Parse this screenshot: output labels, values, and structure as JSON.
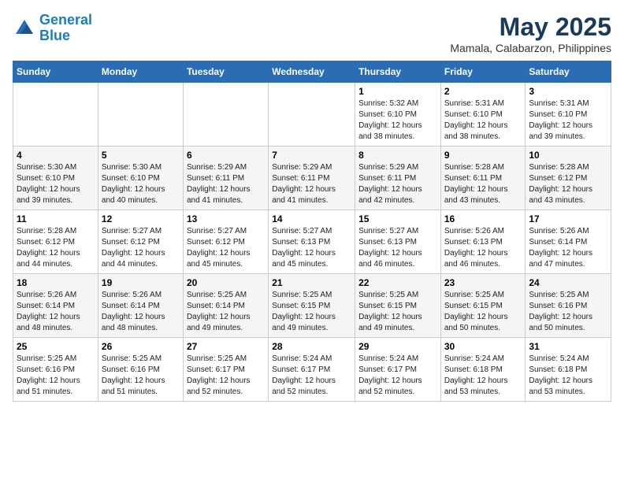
{
  "app": {
    "name": "GeneralBlue",
    "name_part1": "General",
    "name_part2": "Blue"
  },
  "title": {
    "month_year": "May 2025",
    "location": "Mamala, Calabarzon, Philippines"
  },
  "headers": [
    "Sunday",
    "Monday",
    "Tuesday",
    "Wednesday",
    "Thursday",
    "Friday",
    "Saturday"
  ],
  "weeks": [
    {
      "days": [
        {
          "num": "",
          "info": ""
        },
        {
          "num": "",
          "info": ""
        },
        {
          "num": "",
          "info": ""
        },
        {
          "num": "",
          "info": ""
        },
        {
          "num": "1",
          "info": "Sunrise: 5:32 AM\nSunset: 6:10 PM\nDaylight: 12 hours\nand 38 minutes."
        },
        {
          "num": "2",
          "info": "Sunrise: 5:31 AM\nSunset: 6:10 PM\nDaylight: 12 hours\nand 38 minutes."
        },
        {
          "num": "3",
          "info": "Sunrise: 5:31 AM\nSunset: 6:10 PM\nDaylight: 12 hours\nand 39 minutes."
        }
      ]
    },
    {
      "days": [
        {
          "num": "4",
          "info": "Sunrise: 5:30 AM\nSunset: 6:10 PM\nDaylight: 12 hours\nand 39 minutes."
        },
        {
          "num": "5",
          "info": "Sunrise: 5:30 AM\nSunset: 6:10 PM\nDaylight: 12 hours\nand 40 minutes."
        },
        {
          "num": "6",
          "info": "Sunrise: 5:29 AM\nSunset: 6:11 PM\nDaylight: 12 hours\nand 41 minutes."
        },
        {
          "num": "7",
          "info": "Sunrise: 5:29 AM\nSunset: 6:11 PM\nDaylight: 12 hours\nand 41 minutes."
        },
        {
          "num": "8",
          "info": "Sunrise: 5:29 AM\nSunset: 6:11 PM\nDaylight: 12 hours\nand 42 minutes."
        },
        {
          "num": "9",
          "info": "Sunrise: 5:28 AM\nSunset: 6:11 PM\nDaylight: 12 hours\nand 43 minutes."
        },
        {
          "num": "10",
          "info": "Sunrise: 5:28 AM\nSunset: 6:12 PM\nDaylight: 12 hours\nand 43 minutes."
        }
      ]
    },
    {
      "days": [
        {
          "num": "11",
          "info": "Sunrise: 5:28 AM\nSunset: 6:12 PM\nDaylight: 12 hours\nand 44 minutes."
        },
        {
          "num": "12",
          "info": "Sunrise: 5:27 AM\nSunset: 6:12 PM\nDaylight: 12 hours\nand 44 minutes."
        },
        {
          "num": "13",
          "info": "Sunrise: 5:27 AM\nSunset: 6:12 PM\nDaylight: 12 hours\nand 45 minutes."
        },
        {
          "num": "14",
          "info": "Sunrise: 5:27 AM\nSunset: 6:13 PM\nDaylight: 12 hours\nand 45 minutes."
        },
        {
          "num": "15",
          "info": "Sunrise: 5:27 AM\nSunset: 6:13 PM\nDaylight: 12 hours\nand 46 minutes."
        },
        {
          "num": "16",
          "info": "Sunrise: 5:26 AM\nSunset: 6:13 PM\nDaylight: 12 hours\nand 46 minutes."
        },
        {
          "num": "17",
          "info": "Sunrise: 5:26 AM\nSunset: 6:14 PM\nDaylight: 12 hours\nand 47 minutes."
        }
      ]
    },
    {
      "days": [
        {
          "num": "18",
          "info": "Sunrise: 5:26 AM\nSunset: 6:14 PM\nDaylight: 12 hours\nand 48 minutes."
        },
        {
          "num": "19",
          "info": "Sunrise: 5:26 AM\nSunset: 6:14 PM\nDaylight: 12 hours\nand 48 minutes."
        },
        {
          "num": "20",
          "info": "Sunrise: 5:25 AM\nSunset: 6:14 PM\nDaylight: 12 hours\nand 49 minutes."
        },
        {
          "num": "21",
          "info": "Sunrise: 5:25 AM\nSunset: 6:15 PM\nDaylight: 12 hours\nand 49 minutes."
        },
        {
          "num": "22",
          "info": "Sunrise: 5:25 AM\nSunset: 6:15 PM\nDaylight: 12 hours\nand 49 minutes."
        },
        {
          "num": "23",
          "info": "Sunrise: 5:25 AM\nSunset: 6:15 PM\nDaylight: 12 hours\nand 50 minutes."
        },
        {
          "num": "24",
          "info": "Sunrise: 5:25 AM\nSunset: 6:16 PM\nDaylight: 12 hours\nand 50 minutes."
        }
      ]
    },
    {
      "days": [
        {
          "num": "25",
          "info": "Sunrise: 5:25 AM\nSunset: 6:16 PM\nDaylight: 12 hours\nand 51 minutes."
        },
        {
          "num": "26",
          "info": "Sunrise: 5:25 AM\nSunset: 6:16 PM\nDaylight: 12 hours\nand 51 minutes."
        },
        {
          "num": "27",
          "info": "Sunrise: 5:25 AM\nSunset: 6:17 PM\nDaylight: 12 hours\nand 52 minutes."
        },
        {
          "num": "28",
          "info": "Sunrise: 5:24 AM\nSunset: 6:17 PM\nDaylight: 12 hours\nand 52 minutes."
        },
        {
          "num": "29",
          "info": "Sunrise: 5:24 AM\nSunset: 6:17 PM\nDaylight: 12 hours\nand 52 minutes."
        },
        {
          "num": "30",
          "info": "Sunrise: 5:24 AM\nSunset: 6:18 PM\nDaylight: 12 hours\nand 53 minutes."
        },
        {
          "num": "31",
          "info": "Sunrise: 5:24 AM\nSunset: 6:18 PM\nDaylight: 12 hours\nand 53 minutes."
        }
      ]
    }
  ]
}
